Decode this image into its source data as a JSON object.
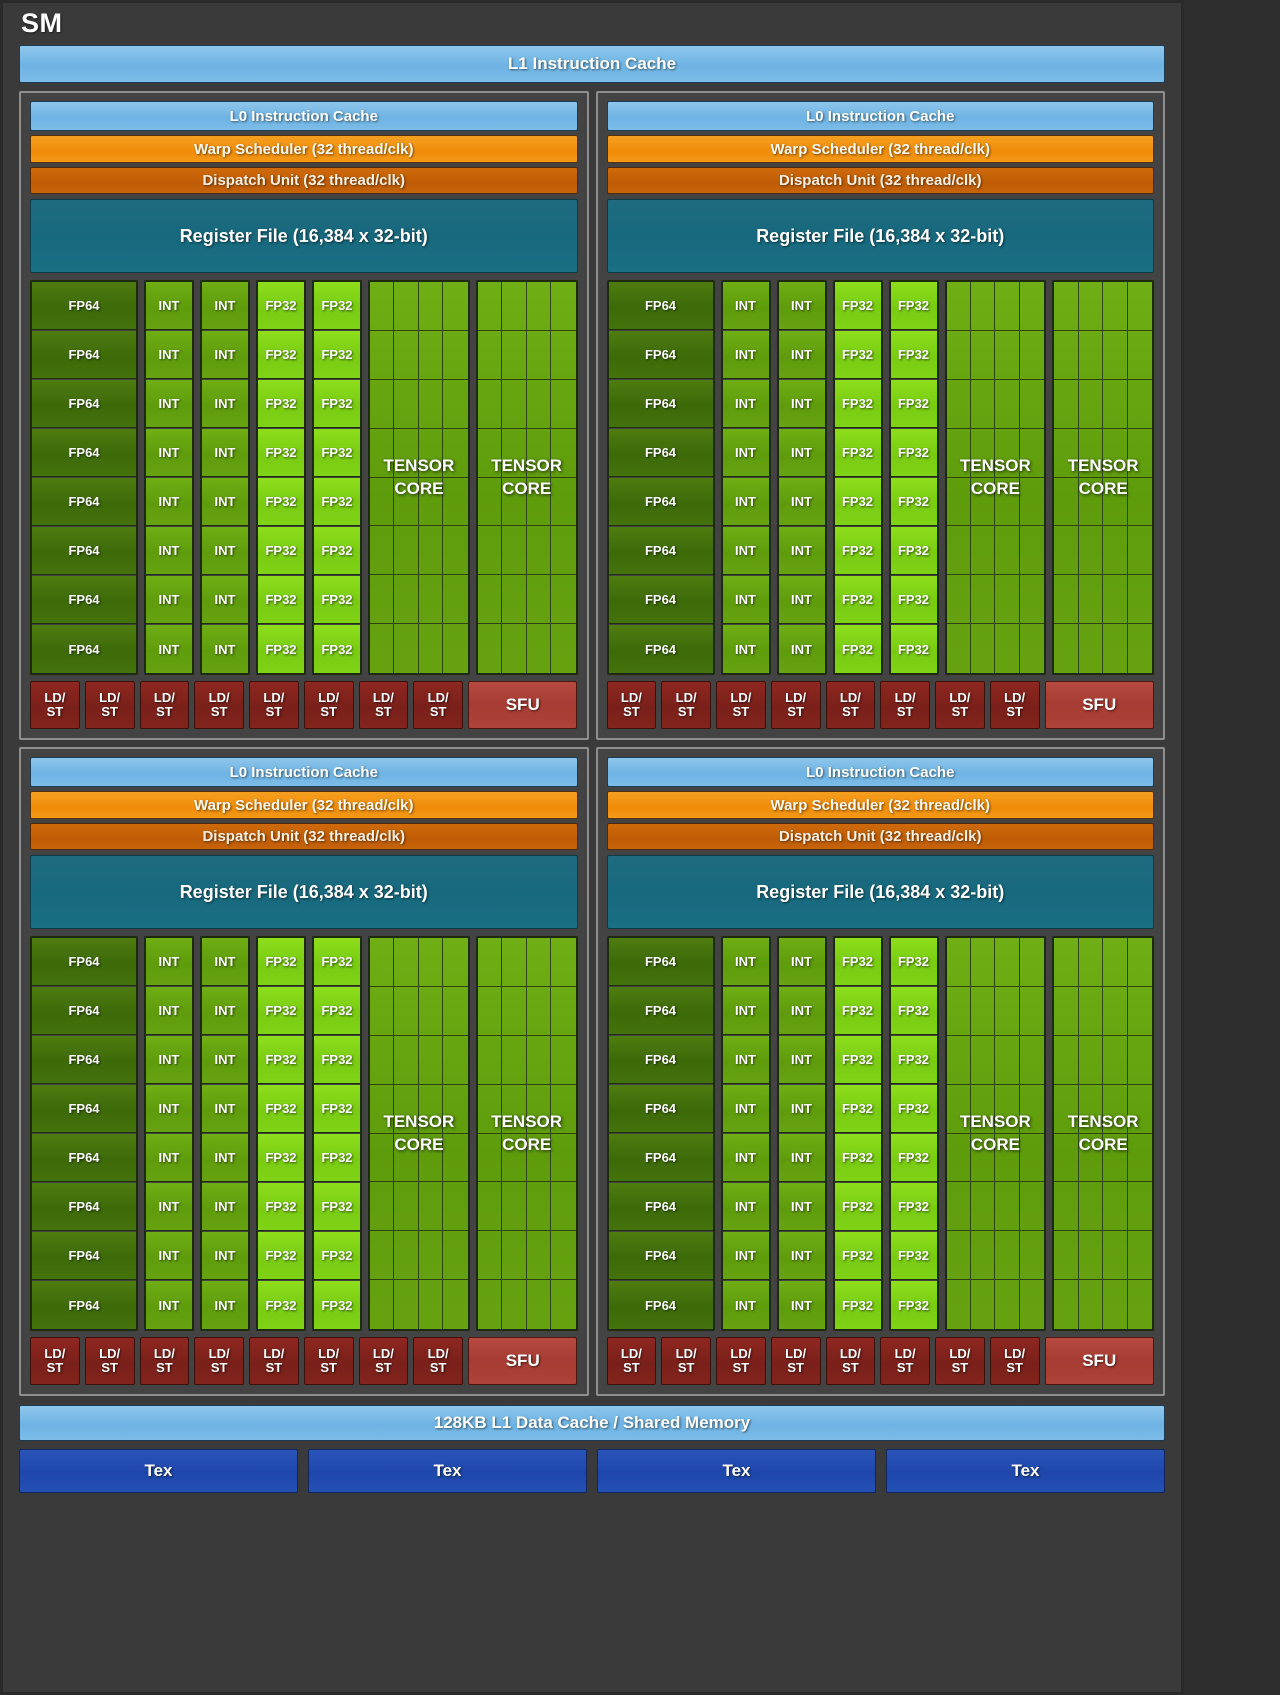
{
  "diagram": {
    "title": "SM",
    "l1_instruction_cache": "L1 Instruction Cache",
    "l1_data_cache": "128KB L1 Data Cache / Shared Memory"
  },
  "partition_labels": {
    "l0_instruction_cache": "L0 Instruction Cache",
    "warp_scheduler": "Warp Scheduler (32 thread/clk)",
    "dispatch_unit": "Dispatch Unit (32 thread/clk)",
    "register_file": "Register File (16,384 x 32-bit)",
    "fp64": "FP64",
    "int": "INT",
    "fp32": "FP32",
    "tensor_core_line1": "TENSOR",
    "tensor_core_line2": "CORE",
    "ldst_line1": "LD/",
    "ldst_line2": "ST",
    "sfu": "SFU"
  },
  "counts": {
    "partitions": 4,
    "rows_per_column": 8,
    "fp64_per_partition": 8,
    "int_columns": 2,
    "int_per_partition": 16,
    "fp32_columns": 2,
    "fp32_per_partition": 16,
    "tensor_cores_per_partition": 2,
    "tensor_subcell_cols": 4,
    "tensor_subcell_rows": 8,
    "ldst_per_partition": 8,
    "sfu_per_partition": 1,
    "tex_units": 4
  },
  "tex_units": [
    {
      "label": "Tex"
    },
    {
      "label": "Tex"
    },
    {
      "label": "Tex"
    },
    {
      "label": "Tex"
    }
  ],
  "colors": {
    "background": "#3a3a3a",
    "partition_border": "#8f8f8f",
    "cache_blue": "#6eb3e3",
    "warp_orange": "#f08c0a",
    "dispatch_orange": "#bf5c05",
    "register_teal": "#17697e",
    "fp64_green": "#3d6a08",
    "int_green": "#5f9c0c",
    "fp32_green": "#79cc12",
    "tensor_green": "#5f9c0c",
    "ldst_red": "#7a201a",
    "sfu_red": "#a63c33",
    "tex_blue": "#1f47ab",
    "title_text": "#ffffff"
  }
}
